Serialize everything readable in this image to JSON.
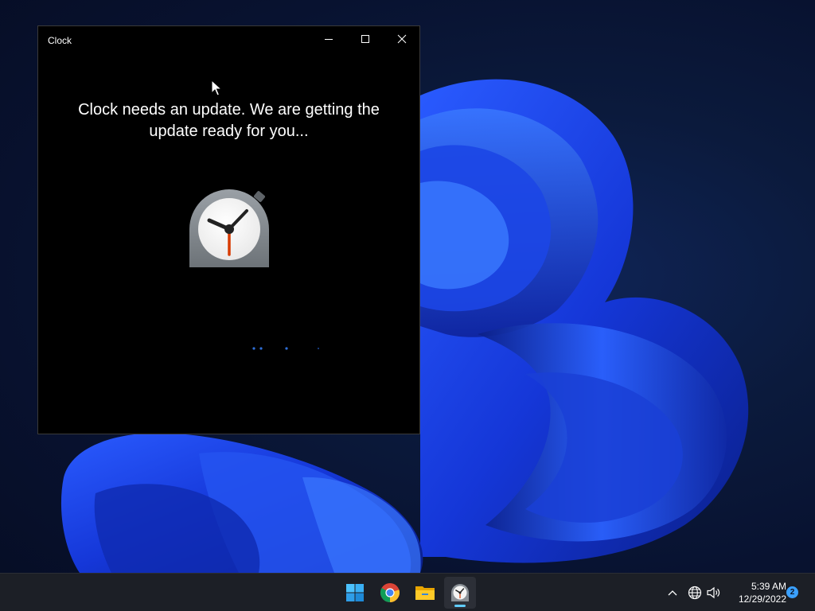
{
  "window": {
    "title": "Clock",
    "message": "Clock needs an update. We are getting the update ready for you..."
  },
  "icons": {
    "minimize": "minimize-icon",
    "maximize": "maximize-icon",
    "close": "close-icon",
    "app": "clock-app-icon",
    "cursor": "cursor-icon"
  },
  "taskbar": {
    "apps": [
      "start-button",
      "chrome",
      "file-explorer",
      "clock"
    ],
    "active_app": "clock"
  },
  "tray": {
    "time": "5:39 AM",
    "date": "12/29/2022",
    "notification_count": "2"
  },
  "colors": {
    "accent": "#60cdff",
    "window_bg": "#000000",
    "taskbar_bg": "#1c1f26",
    "progress_dots": "#2f6fd8"
  }
}
